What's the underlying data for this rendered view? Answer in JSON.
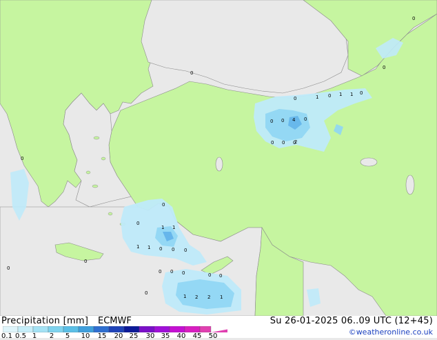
{
  "footer": {
    "title": "Precipitation [mm]",
    "model": "ECMWF",
    "valid_time": "Su 26-01-2025 06..09 UTC (12+45)",
    "credit": "©weatheronline.co.uk"
  },
  "legend": {
    "ticks": [
      "0.1",
      "0.5",
      "1",
      "2",
      "5",
      "10",
      "15",
      "20",
      "25",
      "30",
      "35",
      "40",
      "45",
      "50"
    ],
    "colors": [
      "#dff5fb",
      "#c6eef9",
      "#a4e2f4",
      "#7fd3ee",
      "#5bbfe6",
      "#3f9fdc",
      "#2f6fd0",
      "#1f43b8",
      "#0c1a98",
      "#7a10c8",
      "#a010d8",
      "#c410d2",
      "#d81ec0",
      "#e040b0"
    ]
  },
  "colors": {
    "land": "#c6f5a0",
    "sea": "#e9e9e9",
    "coast": "#8a8a8a",
    "precip_light": "#bfeafa",
    "precip_mid": "#8fd6f4",
    "precip_strong": "#5aaee8"
  },
  "map": {
    "values": [
      "0",
      "1",
      "0",
      "1",
      "0",
      "1",
      "0",
      "0",
      "4",
      "0",
      "0",
      "0",
      "0",
      "0",
      "2",
      "0",
      "1",
      "1",
      "1",
      "1",
      "0",
      "0",
      "0",
      "0",
      "0",
      "0",
      "0",
      "1",
      "2",
      "2",
      "1",
      "0",
      "0",
      "0",
      "0",
      "0",
      "0",
      "0",
      "0"
    ]
  }
}
